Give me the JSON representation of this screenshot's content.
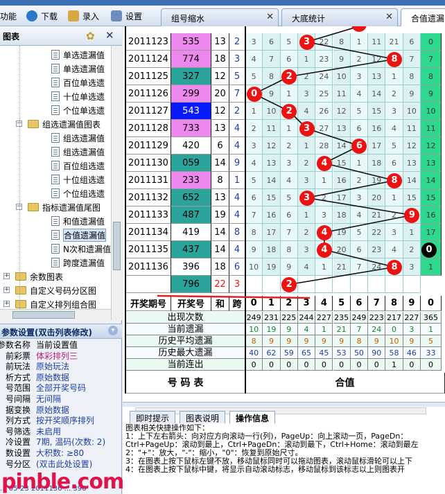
{
  "toolbar": {
    "func_label": "功能",
    "download_label": "下载",
    "input_label": "录入",
    "settings_label": "设置"
  },
  "tabs": [
    {
      "label": "组号缩水"
    },
    {
      "label": "大底统计"
    },
    {
      "label": "合值遗漏"
    }
  ],
  "left_panel": {
    "title": "图表",
    "tree": [
      {
        "label": "单选遗漏值",
        "type": "doc",
        "level": 3
      },
      {
        "label": "单选遗漏值",
        "type": "doc",
        "level": 3
      },
      {
        "label": "百位单选遗",
        "type": "doc",
        "level": 3
      },
      {
        "label": "十位单选遗",
        "type": "doc",
        "level": 3
      },
      {
        "label": "个位单选遗",
        "type": "doc",
        "level": 3
      },
      {
        "label": "组选遗漏值图表",
        "type": "folder",
        "level": 2
      },
      {
        "label": "组选遗漏值",
        "type": "doc",
        "level": 3
      },
      {
        "label": "组选遗漏值",
        "type": "doc",
        "level": 3
      },
      {
        "label": "百位组选遗",
        "type": "doc",
        "level": 3
      },
      {
        "label": "十位组选遗",
        "type": "doc",
        "level": 3
      },
      {
        "label": "个位组选遗",
        "type": "doc",
        "level": 3
      },
      {
        "label": "指标遗漏值尾图",
        "type": "folder",
        "level": 2
      },
      {
        "label": "和值遗漏值",
        "type": "doc",
        "level": 3
      },
      {
        "label": "合值遗漏值",
        "type": "doc",
        "level": 3,
        "selected": true
      },
      {
        "label": "N次和遗漏值",
        "type": "doc",
        "level": 3
      },
      {
        "label": "跨度遗漏值",
        "type": "doc",
        "level": 3
      },
      {
        "label": "余数图表",
        "type": "folder",
        "level": 1
      },
      {
        "label": "自定义号码分区图",
        "type": "folder",
        "level": 1
      },
      {
        "label": "自定义排列组合图",
        "type": "folder",
        "level": 1
      }
    ]
  },
  "params": {
    "title": "参数设置(双击列表修改)",
    "rows": [
      {
        "key": "参数名称",
        "value": "当前设置值"
      },
      {
        "key": "前彩票",
        "value": "体彩排列三"
      },
      {
        "key": "前玩法",
        "value": "原始玩法"
      },
      {
        "key": "析方式",
        "value": "原始数据"
      },
      {
        "key": "号范围",
        "value": "全部开奖号码"
      },
      {
        "key": "号间隔",
        "value": "无间隔"
      },
      {
        "key": "据变换",
        "value": "原始数据"
      },
      {
        "key": "列方式",
        "value": "按开奖顺序排列"
      },
      {
        "key": "号筛选",
        "value": "未启用"
      },
      {
        "key": "冷设置",
        "value": "7期, 温码(次数: 2)"
      },
      {
        "key": "数设置",
        "value": "大积数: ≥80"
      },
      {
        "key": "号分区",
        "value": "(双击此处设置)"
      }
    ],
    "status": "... 05-23 2011136 ... 396"
  },
  "table": {
    "rows": [
      {
        "period": "2011123",
        "num": "535",
        "sum": "13",
        "span": "2",
        "cells": [
          "3",
          "6",
          "5",
          "",
          "22",
          "8",
          "1",
          "11",
          "21",
          "6"
        ],
        "hit": 3,
        "next": "0"
      },
      {
        "period": "2011124",
        "num": "774",
        "sum": "18",
        "span": "3",
        "cells": [
          "4",
          "7",
          "6",
          "1",
          "23",
          "9",
          "2",
          "12",
          "",
          "7"
        ],
        "hit": 8,
        "next": "7"
      },
      {
        "period": "2011125",
        "num": "327",
        "sum": "12",
        "span": "5",
        "cells": [
          "5",
          "8",
          "",
          "2",
          "24",
          "10",
          "3",
          "13",
          "1",
          "8"
        ],
        "hit": 2,
        "next": "8"
      },
      {
        "period": "2011126",
        "num": "299",
        "sum": "20",
        "span": "7",
        "cells": [
          "",
          "9",
          "1",
          "3",
          "25",
          "11",
          "4",
          "14",
          "2",
          "9"
        ],
        "hit": 0,
        "next": "9"
      },
      {
        "period": "2011127",
        "num": "543",
        "sum": "12",
        "span": "2",
        "cells": [
          "1",
          "10",
          "",
          "4",
          "26",
          "12",
          "5",
          "15",
          "3",
          "10"
        ],
        "hit": 2,
        "next": "10"
      },
      {
        "period": "2011128",
        "num": "733",
        "sum": "13",
        "span": "4",
        "cells": [
          "2",
          "11",
          "1",
          "",
          "27",
          "13",
          "6",
          "16",
          "4",
          "11"
        ],
        "hit": 3,
        "next": "11"
      },
      {
        "period": "2011129",
        "num": "420",
        "sum": "6",
        "span": "4",
        "cells": [
          "3",
          "12",
          "2",
          "1",
          "28",
          "14",
          "",
          "17",
          "5",
          "12"
        ],
        "hit": 6,
        "next": "12"
      },
      {
        "period": "2011130",
        "num": "059",
        "sum": "14",
        "span": "9",
        "cells": [
          "4",
          "13",
          "3",
          "2",
          "",
          "15",
          "1",
          "18",
          "6",
          "13"
        ],
        "hit": 4,
        "next": "13"
      },
      {
        "period": "2011131",
        "num": "233",
        "sum": "8",
        "span": "1",
        "cells": [
          "5",
          "14",
          "4",
          "3",
          "1",
          "16",
          "2",
          "19",
          "",
          "14"
        ],
        "hit": 8,
        "next": "14"
      },
      {
        "period": "2011132",
        "num": "652",
        "sum": "13",
        "span": "4",
        "cells": [
          "6",
          "15",
          "5",
          "",
          "2",
          "17",
          "3",
          "20",
          "1",
          "15"
        ],
        "hit": 3,
        "next": "15"
      },
      {
        "period": "2011133",
        "num": "487",
        "sum": "19",
        "span": "4",
        "cells": [
          "7",
          "16",
          "6",
          "1",
          "3",
          "18",
          "4",
          "21",
          "2",
          ""
        ],
        "hit": 9,
        "next": "16"
      },
      {
        "period": "2011134",
        "num": "419",
        "sum": "14",
        "span": "8",
        "cells": [
          "8",
          "17",
          "7",
          "2",
          "",
          "19",
          "5",
          "22",
          "3",
          "1"
        ],
        "hit": 4,
        "next": "17"
      },
      {
        "period": "2011135",
        "num": "437",
        "sum": "14",
        "span": "4",
        "cells": [
          "9",
          "18",
          "8",
          "3",
          "",
          "20",
          "6",
          "23",
          "4",
          "2"
        ],
        "hit": 4,
        "next": "0"
      },
      {
        "period": "2011136",
        "num": "396",
        "sum": "18",
        "span": "6",
        "cells": [
          "10",
          "19",
          "9",
          "4",
          "1",
          "21",
          "7",
          "24",
          "",
          "3"
        ],
        "hit": 8,
        "next": "1"
      },
      {
        "period": "",
        "num": "796",
        "sum": "22",
        "span": "3",
        "cells": [
          "",
          "",
          "",
          "",
          "",
          "",
          "",
          "",
          "",
          ""
        ],
        "hit": 2,
        "next": ""
      }
    ],
    "header": {
      "period": "开奖期号",
      "num": "开奖号",
      "sum": "和",
      "span": "跨",
      "digits": [
        "0",
        "1",
        "2",
        "3",
        "4",
        "5",
        "6",
        "7",
        "8",
        "9",
        "0"
      ]
    },
    "stats": [
      {
        "label": "出现次数",
        "values": [
          "249",
          "231",
          "225",
          "244",
          "227",
          "235",
          "249",
          "223",
          "217",
          "227",
          "365"
        ]
      },
      {
        "label": "当前遗漏",
        "values": [
          "10",
          "19",
          "9",
          "4",
          "1",
          "21",
          "7",
          "24",
          "0",
          "3",
          "1"
        ]
      },
      {
        "label": "历史平均遗漏",
        "values": [
          "8",
          "9",
          "9",
          "9",
          "9",
          "9",
          "8",
          "9",
          "10",
          "9",
          "5"
        ]
      },
      {
        "label": "历史最大遗漏",
        "values": [
          "40",
          "62",
          "59",
          "65",
          "45",
          "53",
          "50",
          "90",
          "58",
          "46",
          "33"
        ]
      },
      {
        "label": "当前连出",
        "values": [
          "0",
          "0",
          "0",
          "0",
          "0",
          "0",
          "0",
          "0",
          "1",
          "0",
          "0"
        ]
      }
    ],
    "footer": {
      "left": "号  码  表",
      "right": "合值"
    }
  },
  "info": {
    "tabs": [
      "即时提示",
      "图表说明",
      "操作信息"
    ],
    "lines": [
      "图表相关快捷操作如下：",
      "  1：上下左右箭头：向对应方向滚动一行(列)，PageUp：向上滚动一页，PageDn：",
      "      Ctrl+PageUp：滚动到最上，Ctrl+PageDn：滚动到最下，Ctrl+Home：滚动到最左",
      "  2：\"+\"：放大，\"-\"：缩小，\"0\"：恢复到原始尺寸。",
      "  3：在图表上按下鼠标左键不放，移动鼠标同时可以拖动图表，滚动鼠标滑轮可以上下",
      "  4：在图表上按下鼠标中键，将显示自动滚动标志，移动鼠标到该标志以上则图表开"
    ]
  },
  "watermark": "pinble.com",
  "colors": {
    "ball": "#ee1111",
    "teal": "#2aa39a",
    "pink": "#ee88ee",
    "blue": "#0a1aff",
    "cyan_col": "#d8f4f4"
  }
}
